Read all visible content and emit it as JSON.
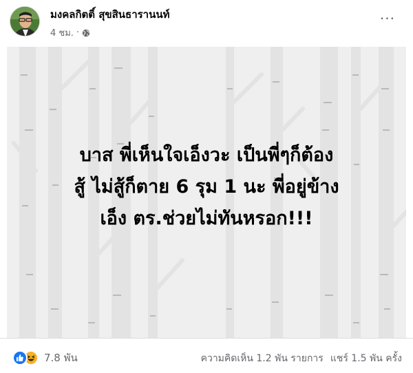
{
  "post": {
    "author": "มงคลกิตติ์ สุขสินธารานนท์",
    "time": "4 ชม.",
    "time_separator": "·",
    "more_label": "···",
    "text_lines": [
      "บาส พี่เห็นใจเอ็งวะ เป็นพี่ๆก็ต้อง",
      "สู้ ไม่สู้ก็ตาย 6 รุม 1 นะ พี่อยู่ข้าง",
      "เอ็ง ตร.ช่วยไม่ทันหรอก!!!"
    ],
    "background_color": "#efefef"
  },
  "footer": {
    "reaction_count": "7.8 พัน",
    "comments": "ความคิดเห็น 1.2 พัน รายการ",
    "shares": "แชร์ 1.5 พัน ครั้ง",
    "like_color": "#1877f2",
    "haha_color": "#f7b125"
  }
}
